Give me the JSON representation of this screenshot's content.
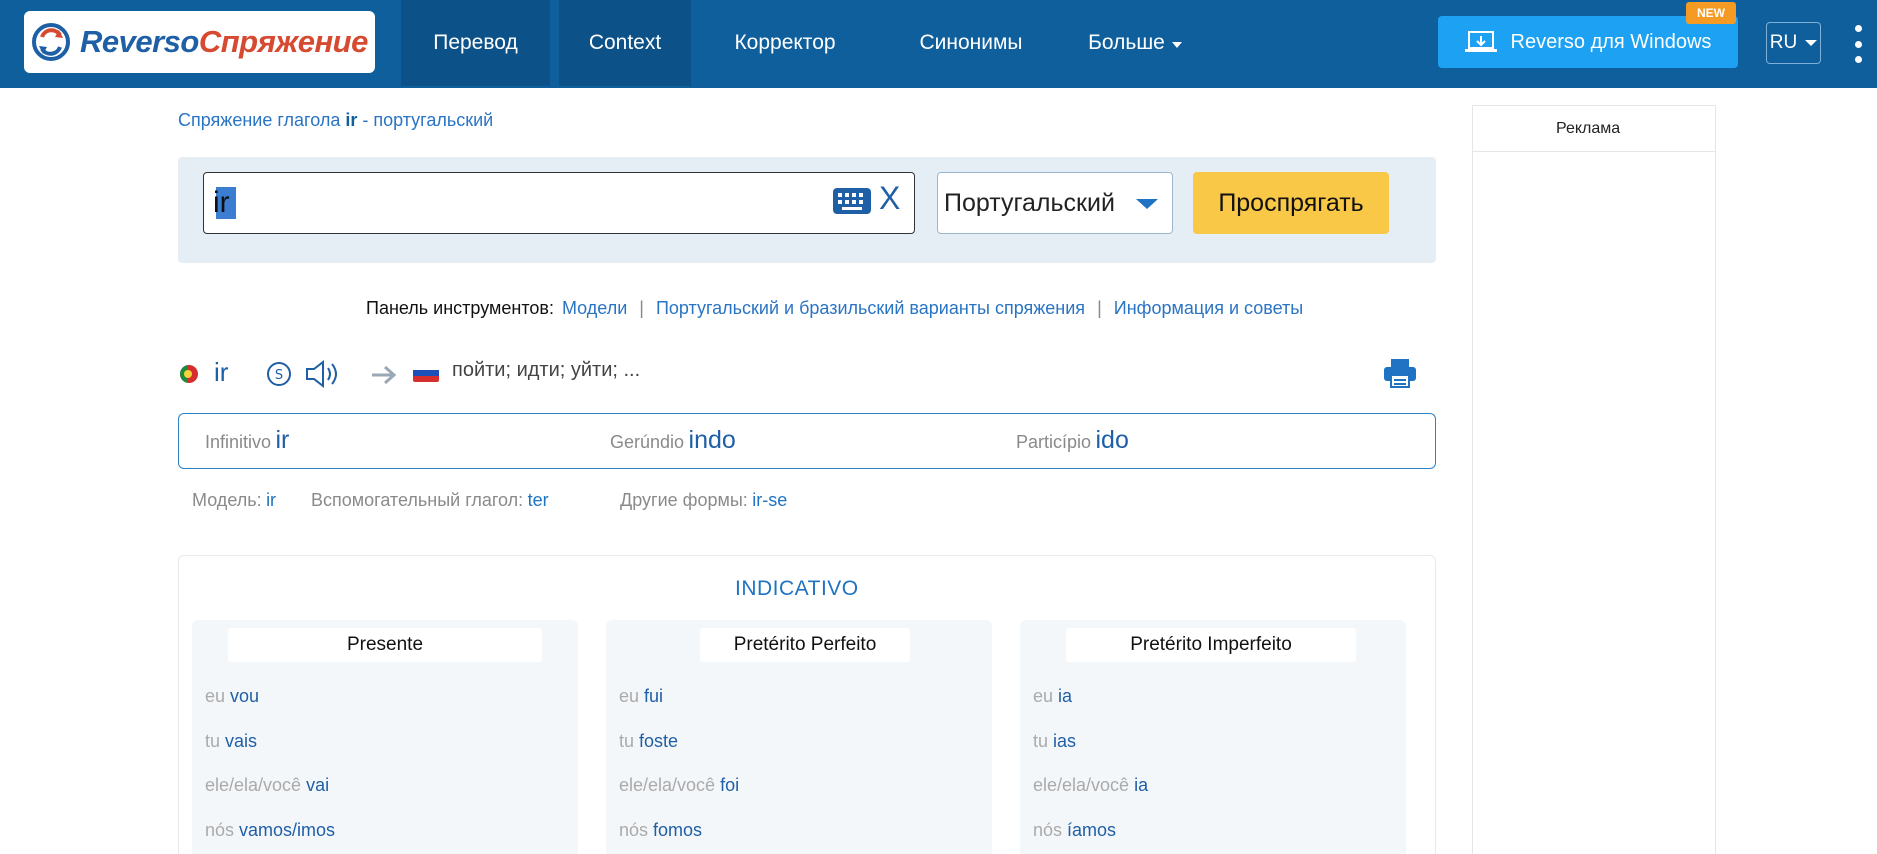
{
  "header": {
    "logo_part1": "Reverso",
    "logo_part2": "Спряжение",
    "nav": {
      "perevod": "Перевод",
      "context": "Context",
      "korrektor": "Корректор",
      "sinonimy": "Синонимы",
      "bolshe": "Больше"
    },
    "windows_button": "Reverso для Windows",
    "new_badge": "NEW",
    "language": "RU"
  },
  "ads": {
    "label": "Реклама"
  },
  "breadcrumb": {
    "prefix": "Спряжение глагола ",
    "verb": "ir",
    "suffix": " - португальский"
  },
  "search": {
    "value": "ir",
    "clear": "X",
    "language_selected": "Португальский",
    "conjugate_button": "Проспрягать"
  },
  "toolbar": {
    "label": "Панель инструментов:",
    "link_models": "Модели",
    "link_variants": "Португальский и бразильский варианты спряжения",
    "link_info": "Информация и советы",
    "separator": "|"
  },
  "verb": {
    "infinitive_display": "ir",
    "translation": "пойти; идти; уйти; ..."
  },
  "info": {
    "infinitivo_label": "Infinitivo",
    "infinitivo_value": "ir",
    "gerundio_label": "Gerúndio",
    "gerundio_value": "indo",
    "participio_label": "Particípio",
    "participio_value": "ido",
    "model_label": "Модель:",
    "model_value": "ir",
    "aux_label": "Вспомогательный глагол:",
    "aux_value": "ter",
    "other_label": "Другие формы:",
    "other_value": "ir-se"
  },
  "conjugation": {
    "mood": "INDICATIVO",
    "tenses": [
      {
        "name": "Presente",
        "rows": [
          {
            "pronoun": "eu",
            "form": "vou"
          },
          {
            "pronoun": "tu",
            "form": "vais"
          },
          {
            "pronoun": "ele/ela/você",
            "form": "vai"
          },
          {
            "pronoun": "nós",
            "form": "vamos/imos"
          }
        ]
      },
      {
        "name": "Pretérito Perfeito",
        "rows": [
          {
            "pronoun": "eu",
            "form": "fui"
          },
          {
            "pronoun": "tu",
            "form": "foste"
          },
          {
            "pronoun": "ele/ela/você",
            "form": "foi"
          },
          {
            "pronoun": "nós",
            "form": "fomos"
          }
        ]
      },
      {
        "name": "Pretérito Imperfeito",
        "rows": [
          {
            "pronoun": "eu",
            "form": "ia"
          },
          {
            "pronoun": "tu",
            "form": "ias"
          },
          {
            "pronoun": "ele/ela/você",
            "form": "ia"
          },
          {
            "pronoun": "nós",
            "form": "íamos"
          }
        ]
      }
    ]
  },
  "colors": {
    "header_bg": "#0f5f9c",
    "brand_blue": "#1f5fa6",
    "brand_red": "#d64a31",
    "conjugate_yellow": "#f9c846",
    "windows_blue": "#1da1f2",
    "new_orange": "#f59b23"
  },
  "icons": [
    "reverso-logo-icon",
    "chevron-down-icon",
    "laptop-download-icon",
    "kebab-menu-icon",
    "keyboard-icon",
    "portugal-flag-icon",
    "slow-audio-icon",
    "speaker-icon",
    "arrow-right-icon",
    "russia-flag-icon",
    "print-icon"
  ]
}
